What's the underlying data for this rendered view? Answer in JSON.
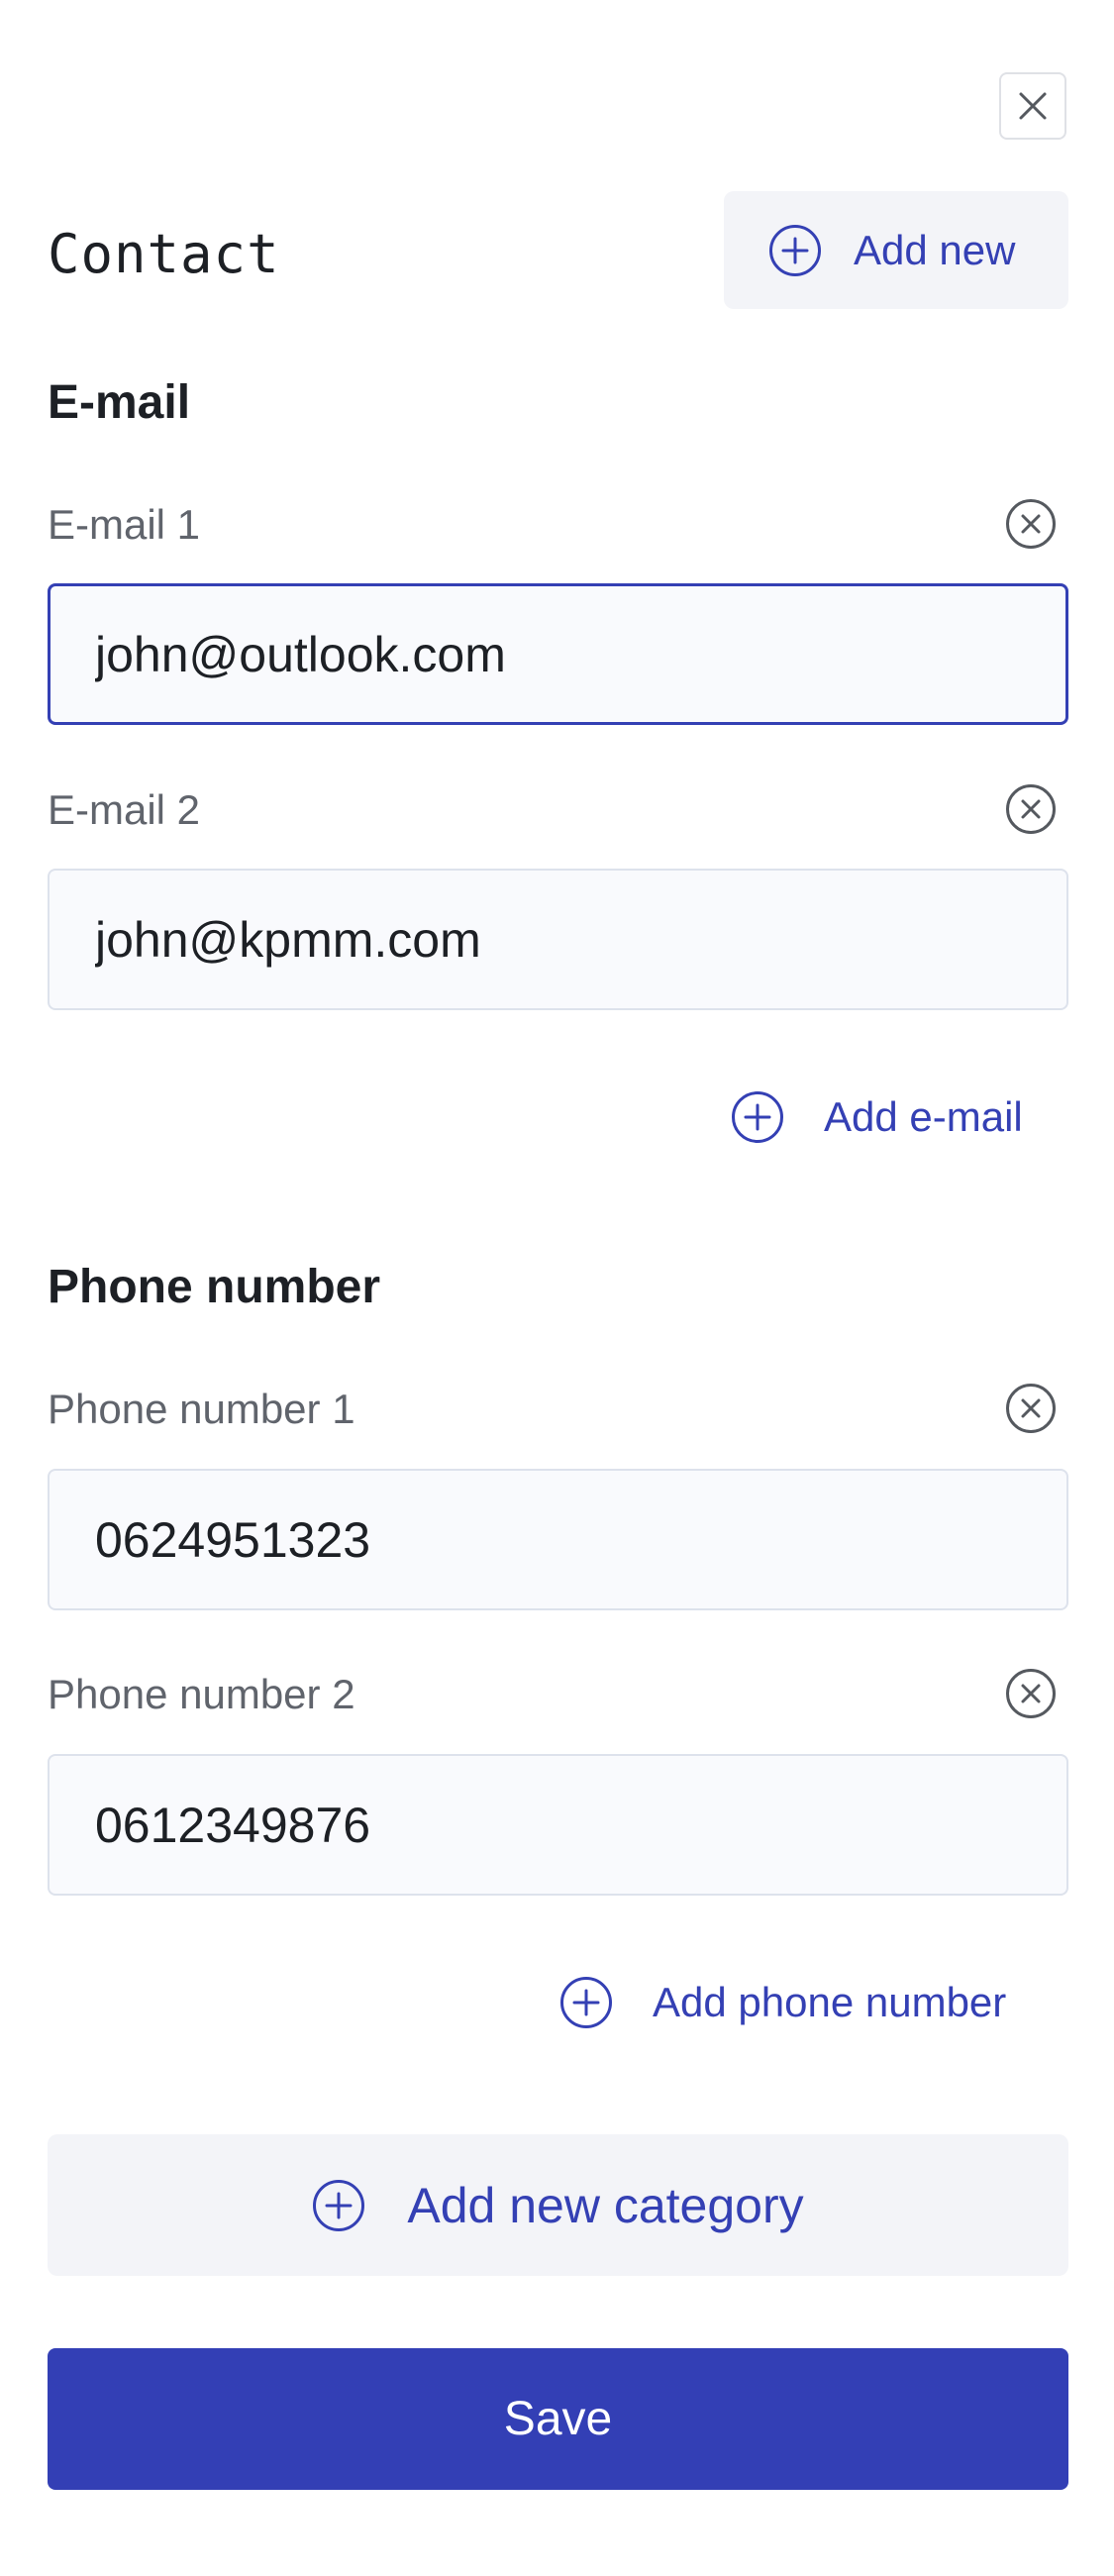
{
  "header": {
    "title": "Contact",
    "add_new_label": "Add new",
    "close_icon": "close-icon"
  },
  "email_section": {
    "title": "E-mail",
    "fields": [
      {
        "label": "E-mail 1",
        "value": "john@outlook.com",
        "focused": true
      },
      {
        "label": "E-mail 2",
        "value": "john@kpmm.com",
        "focused": false
      }
    ],
    "add_label": "Add e-mail"
  },
  "phone_section": {
    "title": "Phone number",
    "fields": [
      {
        "label": "Phone number 1",
        "value": "0624951323"
      },
      {
        "label": "Phone number 2",
        "value": "0612349876"
      }
    ],
    "add_label": "Add phone number"
  },
  "add_category_label": "Add new category",
  "save_label": "Save",
  "colors": {
    "accent": "#3440b4",
    "button_bg": "#f3f4f8",
    "input_bg": "#f9fafd",
    "input_border": "#dde2ec"
  }
}
